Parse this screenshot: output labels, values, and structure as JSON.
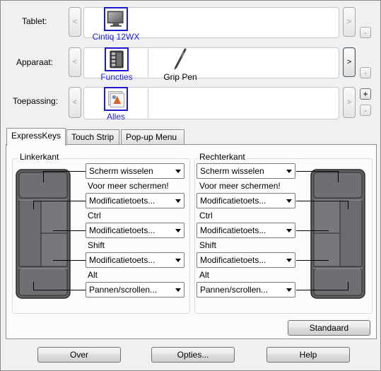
{
  "rows": {
    "tablet": {
      "label": "Tablet:",
      "items": [
        {
          "label": "Cintiq 12WX",
          "icon": "tablet-monitor-icon",
          "selected": true
        }
      ]
    },
    "device": {
      "label": "Apparaat:",
      "items": [
        {
          "label": "Functies",
          "icon": "functions-icon",
          "selected": true
        },
        {
          "label": "Grip Pen",
          "icon": "pen-icon",
          "selected": false
        }
      ]
    },
    "application": {
      "label": "Toepassing:",
      "items": [
        {
          "label": "Alles",
          "icon": "all-applications-icon",
          "selected": true
        }
      ]
    }
  },
  "nav": {
    "prev": "<",
    "next": ">",
    "add": "+",
    "remove": "-"
  },
  "tabs": [
    "ExpressKeys",
    "Touch Strip",
    "Pop-up Menu"
  ],
  "left_group": {
    "title": "Linkerkant",
    "keys": [
      {
        "value": "Scherm wisselen",
        "note": "Voor meer schermen!"
      },
      {
        "value": "Modificatietoets...",
        "note": "Ctrl"
      },
      {
        "value": "Modificatietoets...",
        "note": "Shift"
      },
      {
        "value": "Modificatietoets...",
        "note": "Alt"
      },
      {
        "value": "Pannen/scrollen...",
        "note": ""
      }
    ]
  },
  "right_group": {
    "title": "Rechterkant",
    "keys": [
      {
        "value": "Scherm wisselen",
        "note": "Voor meer schermen!"
      },
      {
        "value": "Modificatietoets...",
        "note": "Ctrl"
      },
      {
        "value": "Modificatietoets...",
        "note": "Shift"
      },
      {
        "value": "Modificatietoets...",
        "note": "Alt"
      },
      {
        "value": "Pannen/scrollen...",
        "note": ""
      }
    ]
  },
  "buttons": {
    "default": "Standaard",
    "about": "Over",
    "options": "Opties...",
    "help": "Help"
  }
}
